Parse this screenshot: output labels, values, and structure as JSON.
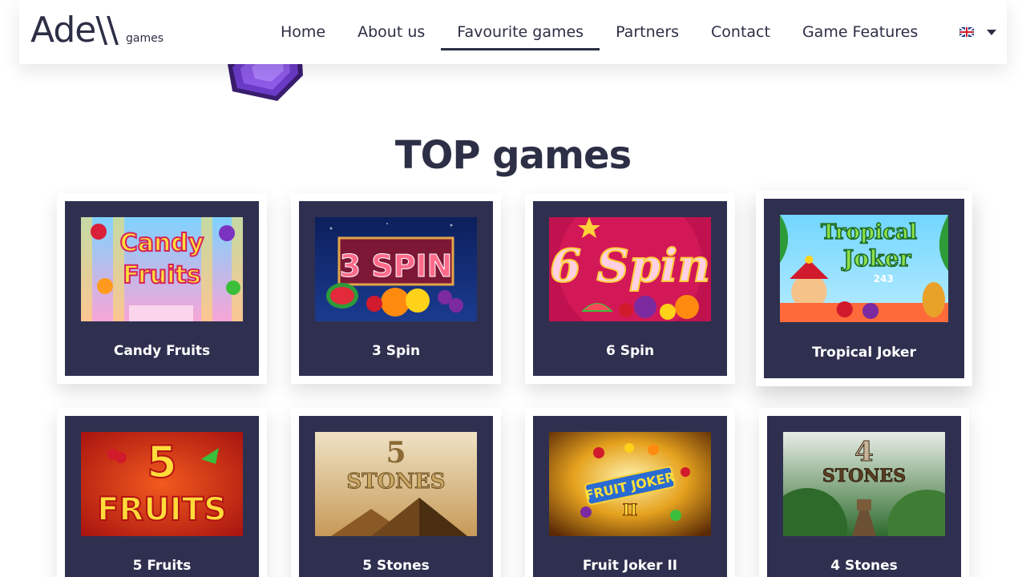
{
  "header": {
    "logo_main": "Ade\\\\",
    "logo_sub": "games",
    "nav": [
      "Home",
      "About us",
      "Favourite games",
      "Partners",
      "Contact",
      "Game Features"
    ],
    "active_nav": "Favourite games",
    "language_icon": "uk-flag-icon"
  },
  "section": {
    "title": "TOP games"
  },
  "games": [
    {
      "title": "Candy Fruits",
      "thumb_text": "Candy Fruits"
    },
    {
      "title": "3 Spin",
      "thumb_text": "3 SPIN"
    },
    {
      "title": "6 Spin",
      "thumb_text": "6 Spin"
    },
    {
      "title": "Tropical Joker",
      "thumb_text": "Tropical Joker",
      "thumb_sub": "243"
    },
    {
      "title": "5 Fruits",
      "thumb_text": "5 FRUITS"
    },
    {
      "title": "5 Stones",
      "thumb_text": "5 STONES"
    },
    {
      "title": "Fruit Joker II",
      "thumb_text": "FRUIT JOKER II"
    },
    {
      "title": "4 Stones",
      "thumb_text": "4 STONES"
    }
  ],
  "colors": {
    "brand_dark": "#2c2f45",
    "card_bg": "#2f3050"
  }
}
